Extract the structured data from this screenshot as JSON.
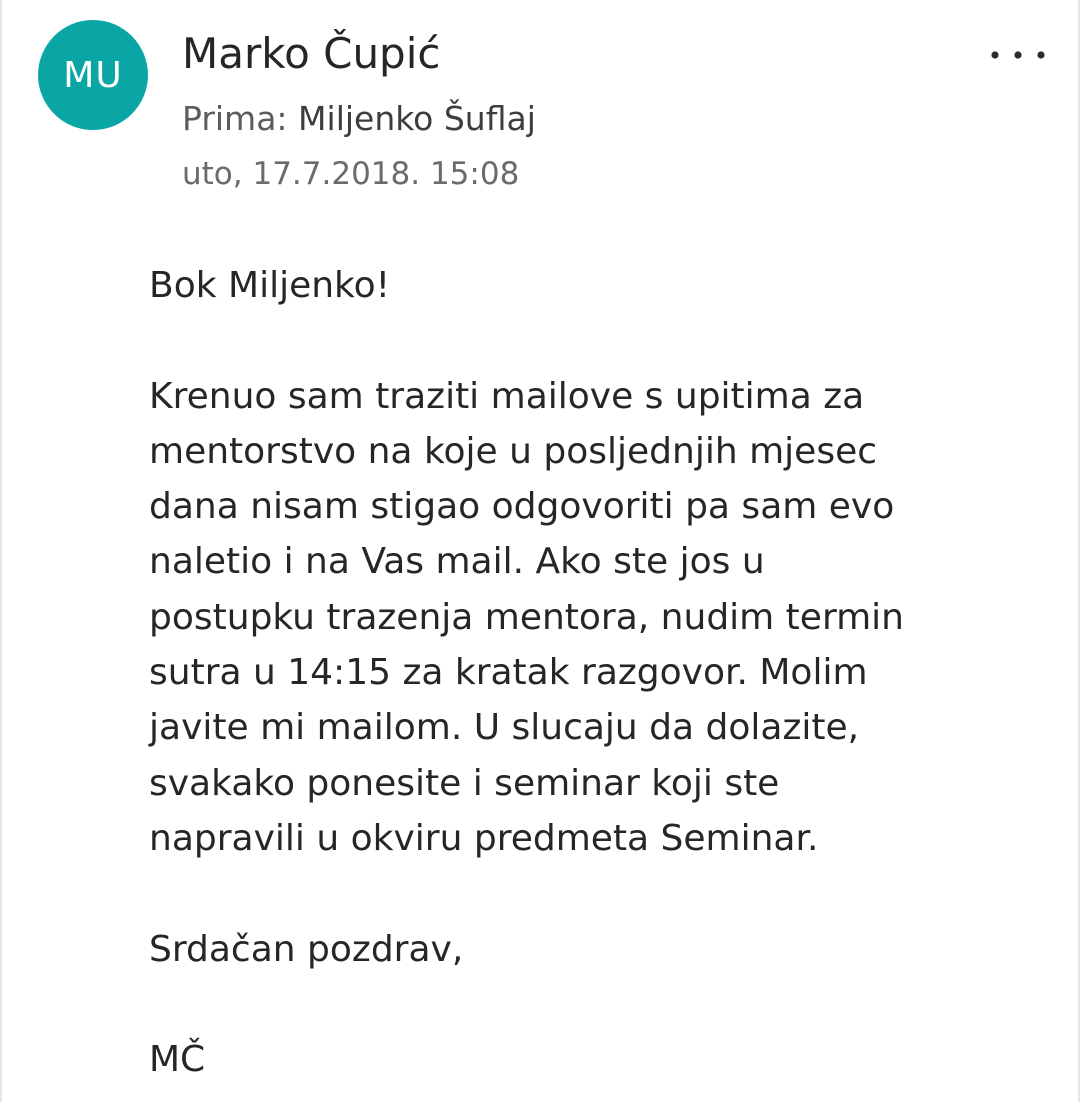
{
  "colors": {
    "avatar_bg": "#0aa6a6",
    "text_primary": "#262626",
    "text_secondary": "#6b6b6b"
  },
  "header": {
    "avatar_initials": "MU",
    "sender_name": "Marko Čupić",
    "recipient_prefix": "Prima:",
    "recipient_name": "Miljenko Šuflaj",
    "date": "uto, 17.7.2018. 15:08",
    "more_icon": "more-horizontal-icon"
  },
  "message": {
    "greeting": "Bok Miljenko!",
    "paragraph": "Krenuo sam traziti mailove s upitima za\nmentorstvo na koje u posljednjih mjesec\ndana nisam stigao odgovoriti pa sam evo\nnaletio i na Vas mail. Ako ste jos u\npostupku trazenja mentora, nudim termin\nsutra u 14:15 za kratak razgovor. Molim\njavite mi mailom. U slucaju da dolazite,\nsvakako ponesite i seminar koji ste\nnapravili u okviru predmeta Seminar.",
    "closing": "Srdačan pozdrav,",
    "signature": "MČ"
  }
}
